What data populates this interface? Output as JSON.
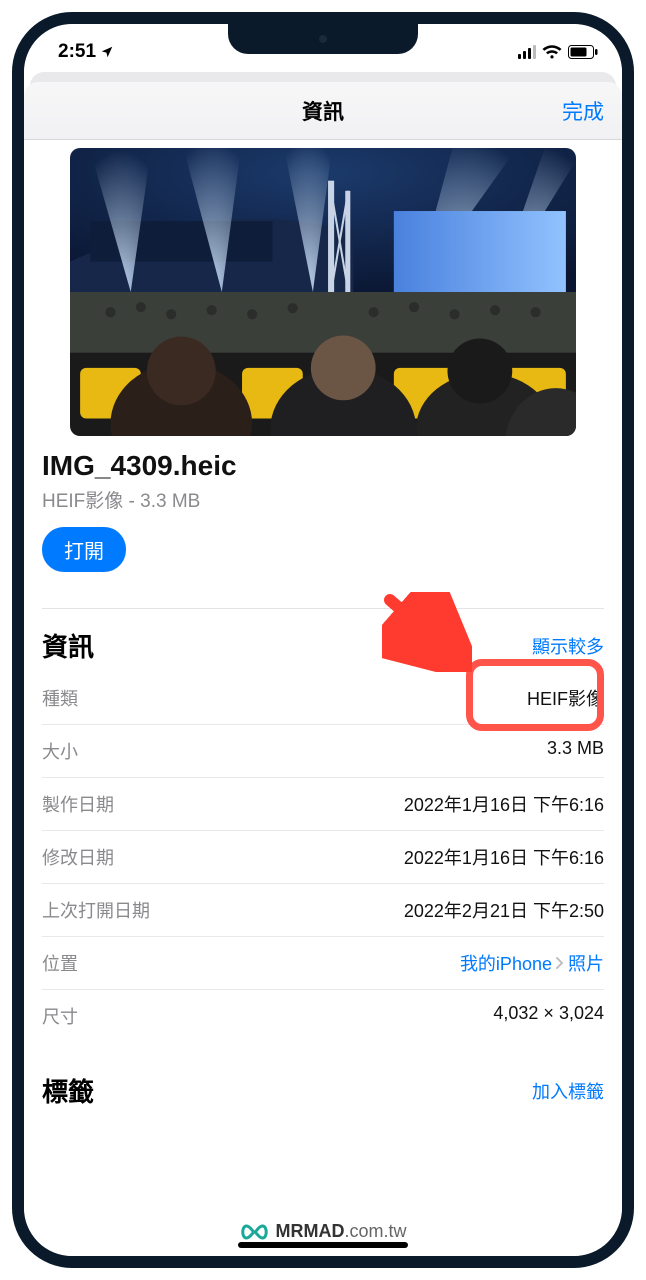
{
  "status": {
    "time": "2:51"
  },
  "modal": {
    "title": "資訊",
    "done": "完成"
  },
  "file": {
    "name": "IMG_4309.heic",
    "subtitle": "HEIF影像 - 3.3 MB",
    "open": "打開"
  },
  "info": {
    "section_title": "資訊",
    "show_more": "顯示較多",
    "rows": {
      "kind_label": "種類",
      "kind_value": "HEIF影像",
      "size_label": "大小",
      "size_value": "3.3 MB",
      "created_label": "製作日期",
      "created_value": "2022年1月16日 下午6:16",
      "modified_label": "修改日期",
      "modified_value": "2022年1月16日 下午6:16",
      "opened_label": "上次打開日期",
      "opened_value": "2022年2月21日 下午2:50",
      "location_label": "位置",
      "location_value_device": "我的iPhone",
      "location_value_folder": "照片",
      "dimensions_label": "尺寸",
      "dimensions_value": "4,032 × 3,024"
    }
  },
  "tags": {
    "section_title": "標籤",
    "add": "加入標籤"
  },
  "watermark": {
    "brand": "MRMAD",
    "domain": ".com.tw"
  }
}
